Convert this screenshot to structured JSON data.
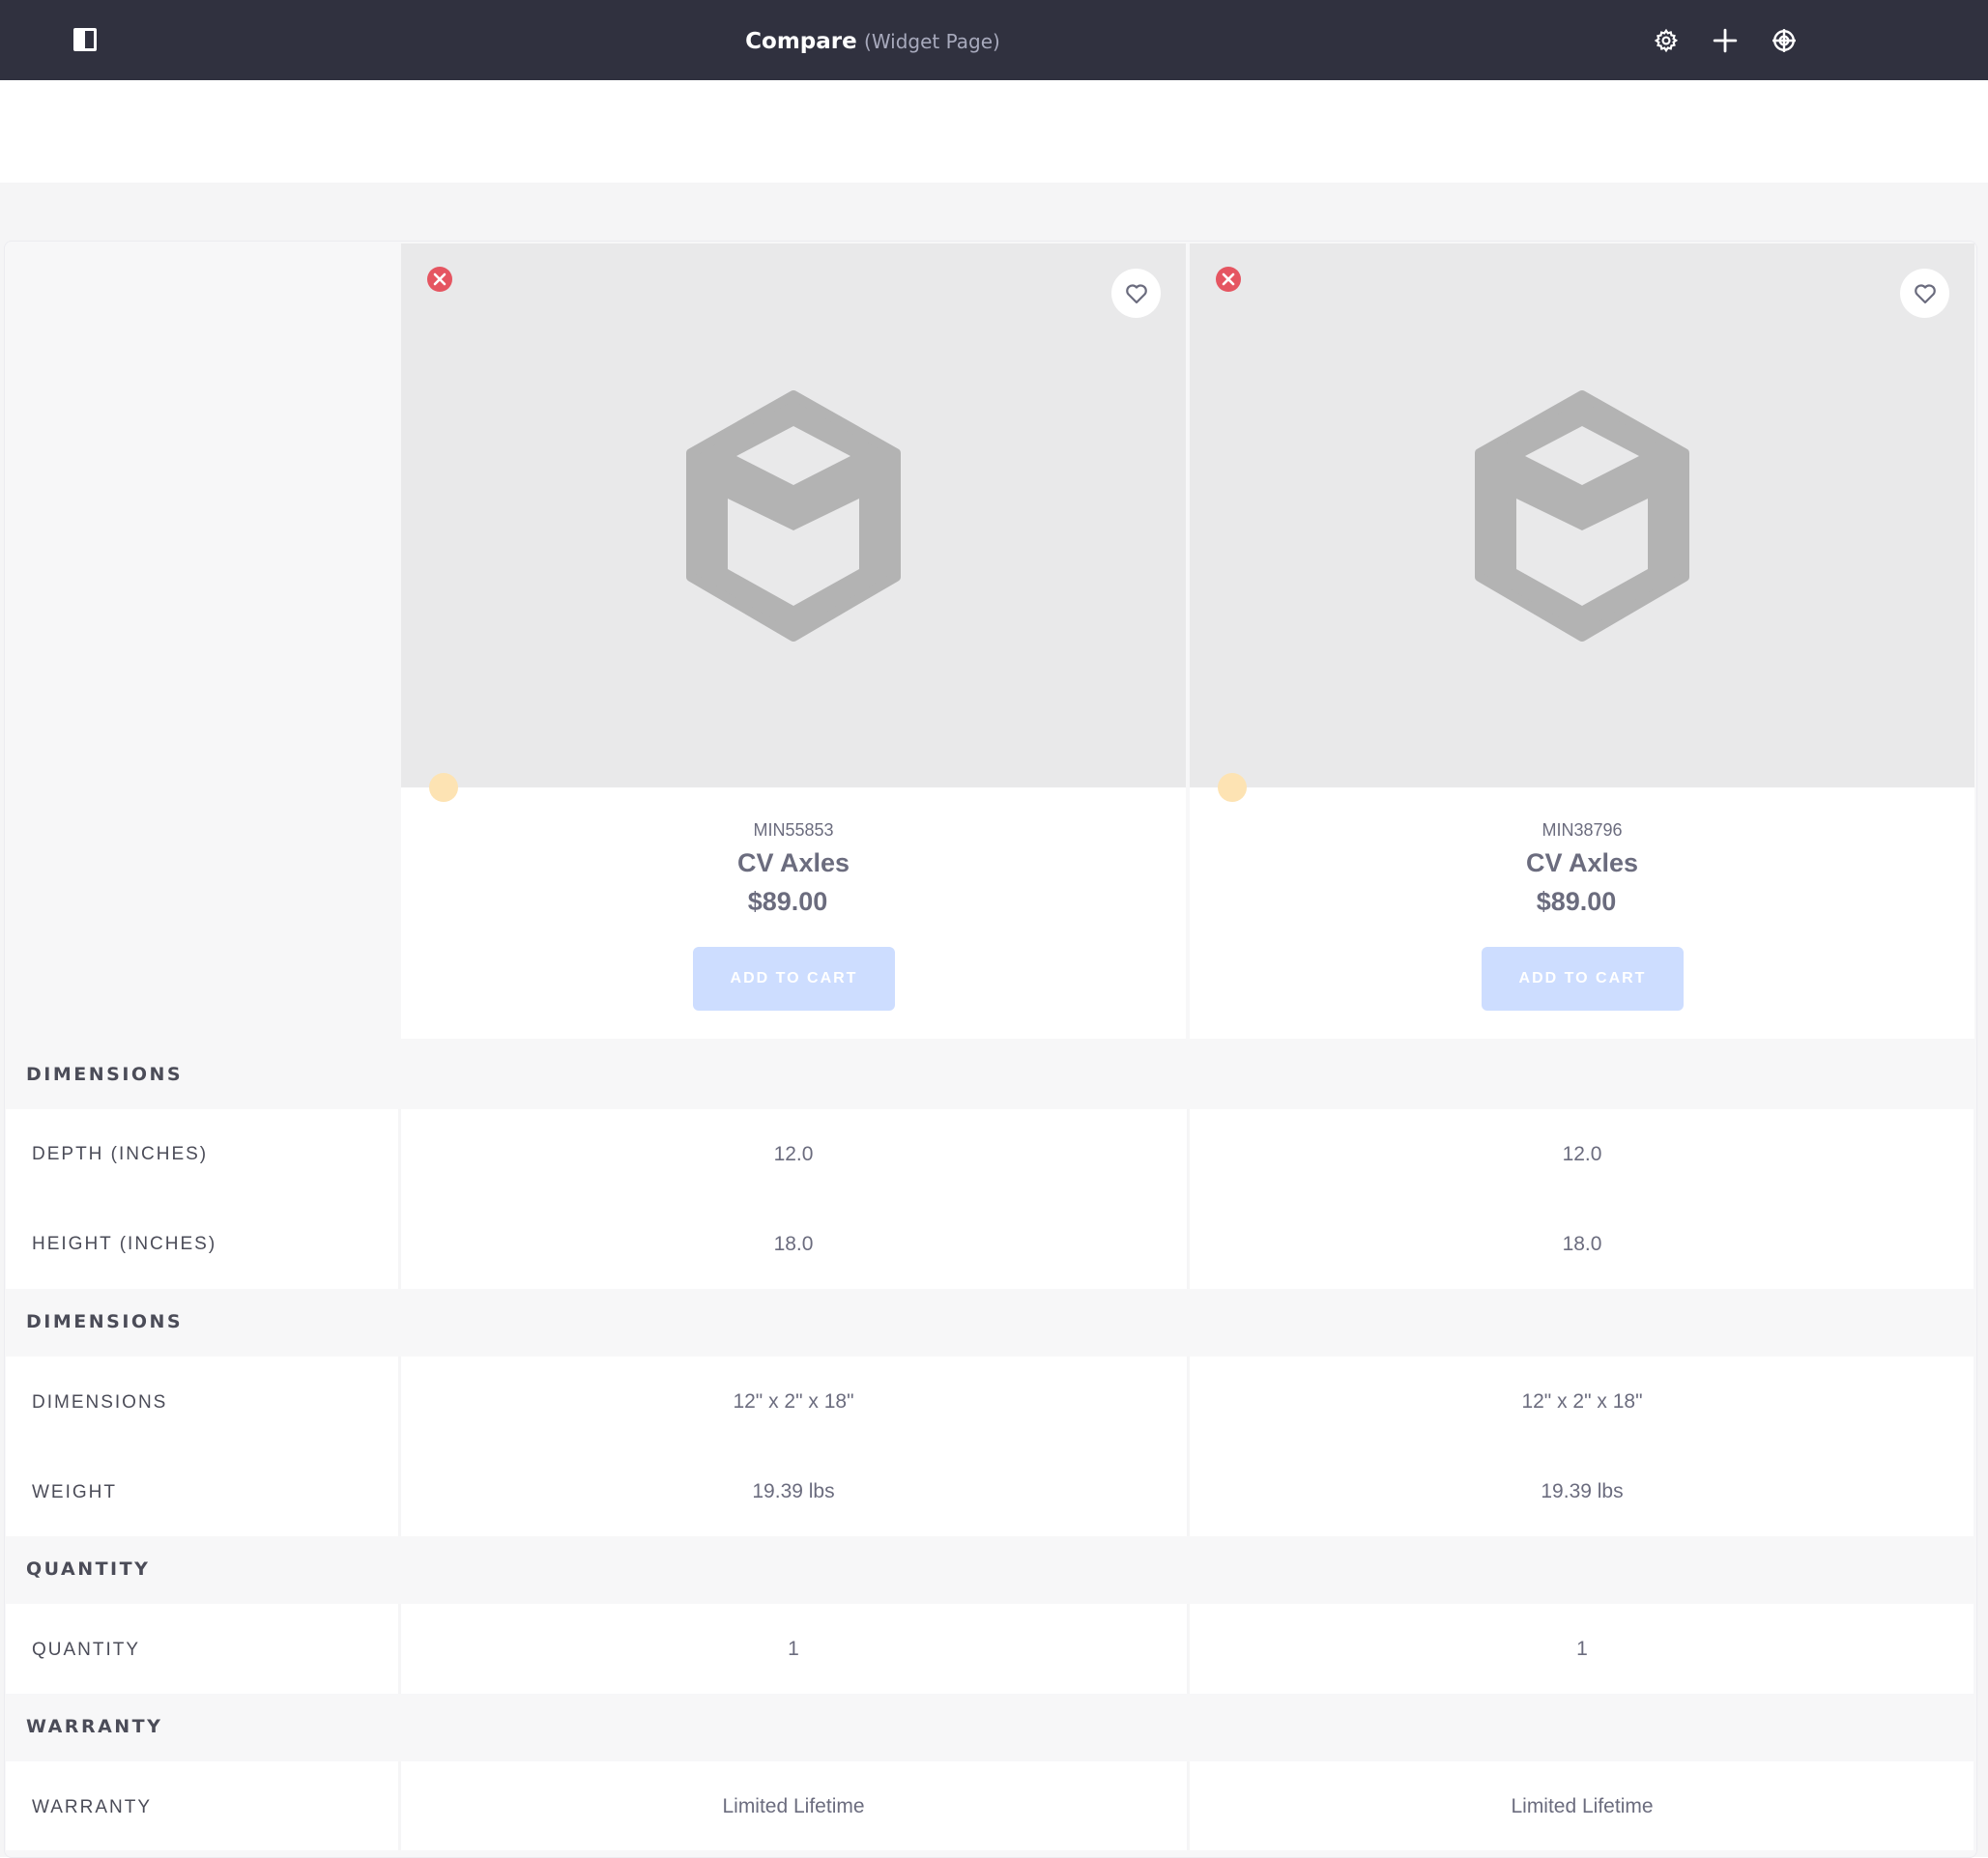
{
  "topbar": {
    "title": "Compare",
    "subtitle": "(Widget Page)",
    "icons": [
      "sidebar-toggle-icon",
      "gear-icon",
      "plus-icon",
      "target-icon"
    ]
  },
  "products": [
    {
      "sku": "MIN55853",
      "name": "CV Axles",
      "price": "$89.00",
      "add_to_cart": "ADD TO CART"
    },
    {
      "sku": "MIN38796",
      "name": "CV Axles",
      "price": "$89.00",
      "add_to_cart": "ADD TO CART"
    }
  ],
  "sections": [
    {
      "title": "DIMENSIONS",
      "rows": [
        {
          "label": "DEPTH (INCHES)",
          "values": [
            "12.0",
            "12.0"
          ]
        },
        {
          "label": "HEIGHT (INCHES)",
          "values": [
            "18.0",
            "18.0"
          ]
        }
      ]
    },
    {
      "title": "DIMENSIONS",
      "rows": [
        {
          "label": "DIMENSIONS",
          "values": [
            "12\" x 2\" x 18\"",
            "12\" x 2\" x 18\""
          ]
        },
        {
          "label": "WEIGHT",
          "values": [
            "19.39 lbs",
            "19.39 lbs"
          ]
        }
      ]
    },
    {
      "title": "QUANTITY",
      "rows": [
        {
          "label": "QUANTITY",
          "values": [
            "1",
            "1"
          ]
        }
      ]
    },
    {
      "title": "WARRANTY",
      "rows": [
        {
          "label": "WARRANTY",
          "values": [
            "Limited Lifetime",
            "Limited Lifetime"
          ]
        }
      ]
    }
  ],
  "colors": {
    "topbar": "#30313f",
    "remove": "#e55561",
    "add_to_cart_disabled": "#cdddff",
    "placeholder_icon": "#b3b3b3",
    "status_dot": "#fde3b3"
  }
}
